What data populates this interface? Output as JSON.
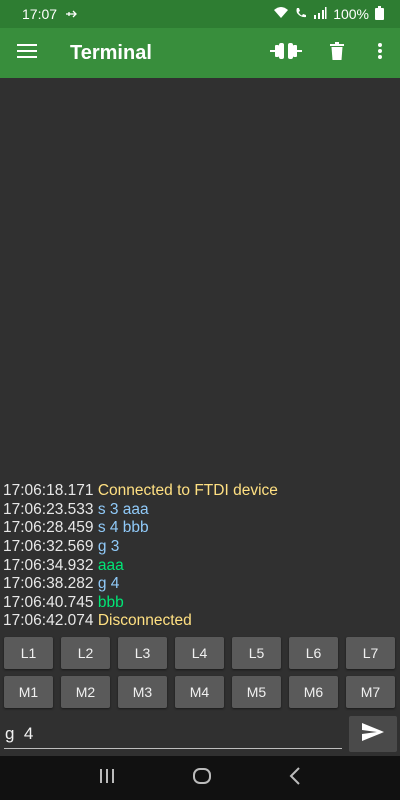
{
  "status_bar": {
    "time": "17:07",
    "battery": "100%"
  },
  "app_bar": {
    "title": "Terminal"
  },
  "terminal": {
    "lines": [
      {
        "time": "17:06:18.171",
        "text": "Connected to FTDI device",
        "color": "#ffe082"
      },
      {
        "time": "17:06:23.533",
        "text": "s 3 aaa",
        "color": "#90caf9"
      },
      {
        "time": "17:06:28.459",
        "text": "s 4 bbb",
        "color": "#90caf9"
      },
      {
        "time": "17:06:32.569",
        "text": "g 3",
        "color": "#90caf9"
      },
      {
        "time": "17:06:34.932",
        "text": "aaa",
        "color": "#00e676"
      },
      {
        "time": "17:06:38.282",
        "text": "g 4",
        "color": "#90caf9"
      },
      {
        "time": "17:06:40.745",
        "text": "bbb",
        "color": "#00e676"
      },
      {
        "time": "17:06:42.074",
        "text": "Disconnected",
        "color": "#ffe082"
      }
    ]
  },
  "macro_keys": {
    "row1": [
      "L1",
      "L2",
      "L3",
      "L4",
      "L5",
      "L6",
      "L7"
    ],
    "row2": [
      "M1",
      "M2",
      "M3",
      "M4",
      "M5",
      "M6",
      "M7"
    ]
  },
  "input": {
    "value": "g  4",
    "placeholder": ""
  },
  "icons": {
    "menu": "hamburger-icon",
    "connect": "connection-plug-icon",
    "clear": "trash-icon",
    "overflow": "more-vert-icon",
    "send": "send-icon"
  },
  "colors": {
    "app_bar": "#388e3c",
    "status_bar": "#2e7d32",
    "terminal_bg": "#303030",
    "key_bg": "#5a5a5a"
  }
}
